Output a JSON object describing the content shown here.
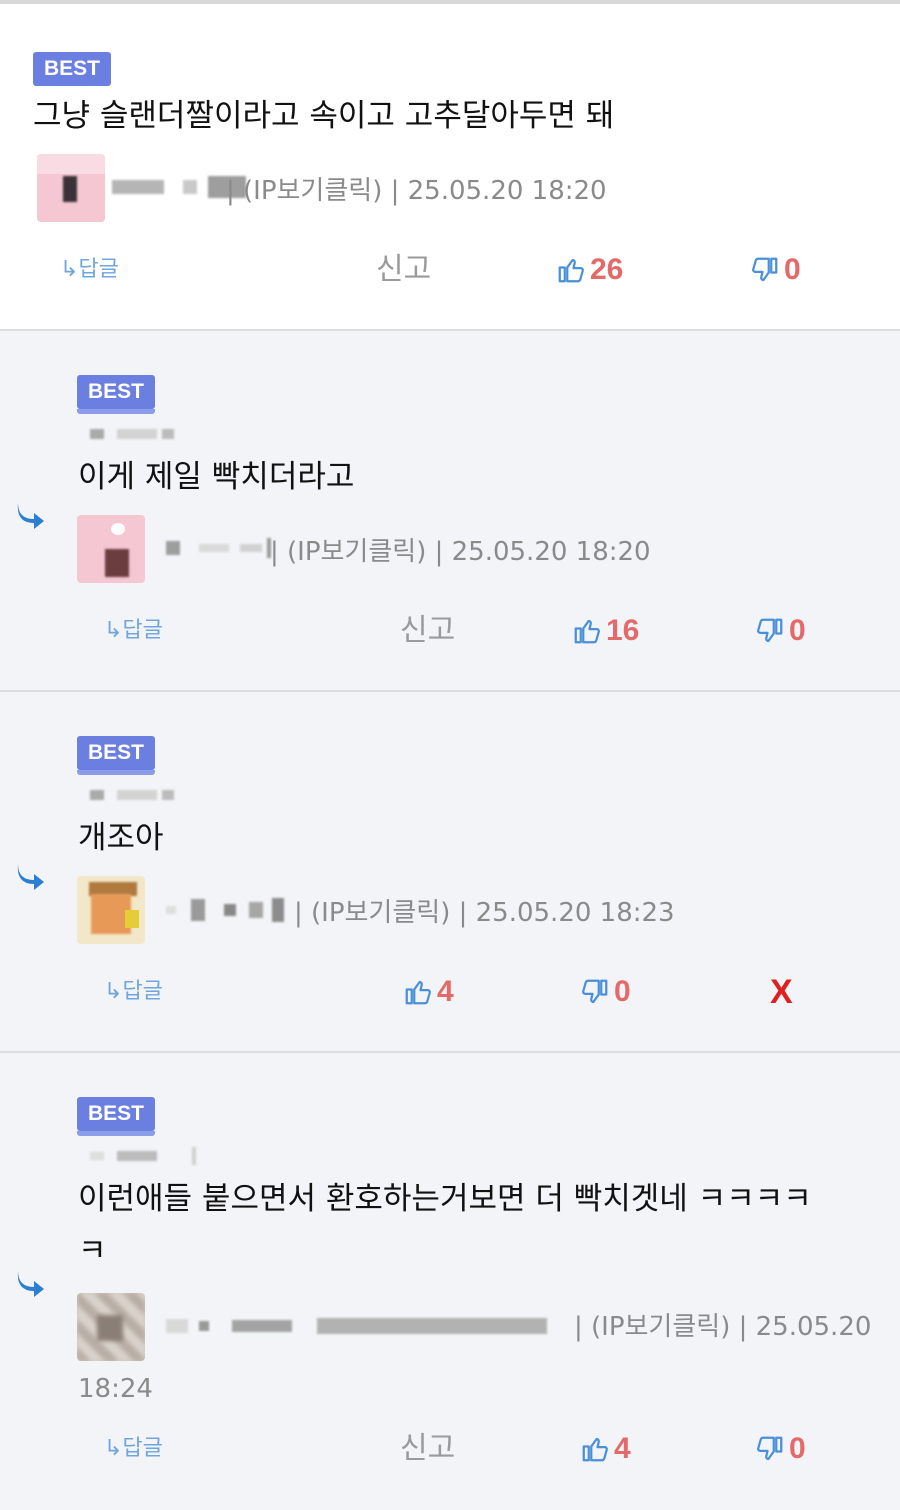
{
  "comments": [
    {
      "badge": "BEST",
      "text": "그냥 슬랜더짤이라고 속이고 고추달아두면 돼",
      "meta": "| (IP보기클릭) | 25.05.20 18:20",
      "reply_label": "↳답글",
      "report_label": "신고",
      "up_count": "26",
      "down_count": "0"
    },
    {
      "badge": "BEST",
      "text": "이게 제일 빡치더라고",
      "meta": "| (IP보기클릭) | 25.05.20 18:20",
      "reply_label": "↳답글",
      "report_label": "신고",
      "up_count": "16",
      "down_count": "0"
    },
    {
      "badge": "BEST",
      "text": "개조아",
      "meta": "| (IP보기클릭) | 25.05.20 18:23",
      "reply_label": "↳답글",
      "up_count": "4",
      "down_count": "0",
      "delete_label": "X"
    },
    {
      "badge": "BEST",
      "text_line1": "이런애들 붙으면서 환호하는거보면 더 빡치겟네 ㅋㅋㅋㅋ",
      "text_line2": "ㅋ",
      "meta": "| (IP보기클릭) | 25.05.20",
      "meta_time": "18:24",
      "reply_label": "↳답글",
      "report_label": "신고",
      "up_count": "4",
      "down_count": "0"
    }
  ],
  "colors": {
    "badge": "#6a7fe0",
    "vote_count": "#e46a6a",
    "icon_blue": "#4a90d9",
    "delete": "#e02020",
    "nested_bg": "#f3f4f7"
  },
  "icons": [
    "thumbs-up-icon",
    "thumbs-down-icon",
    "reply-arrow-icon"
  ]
}
